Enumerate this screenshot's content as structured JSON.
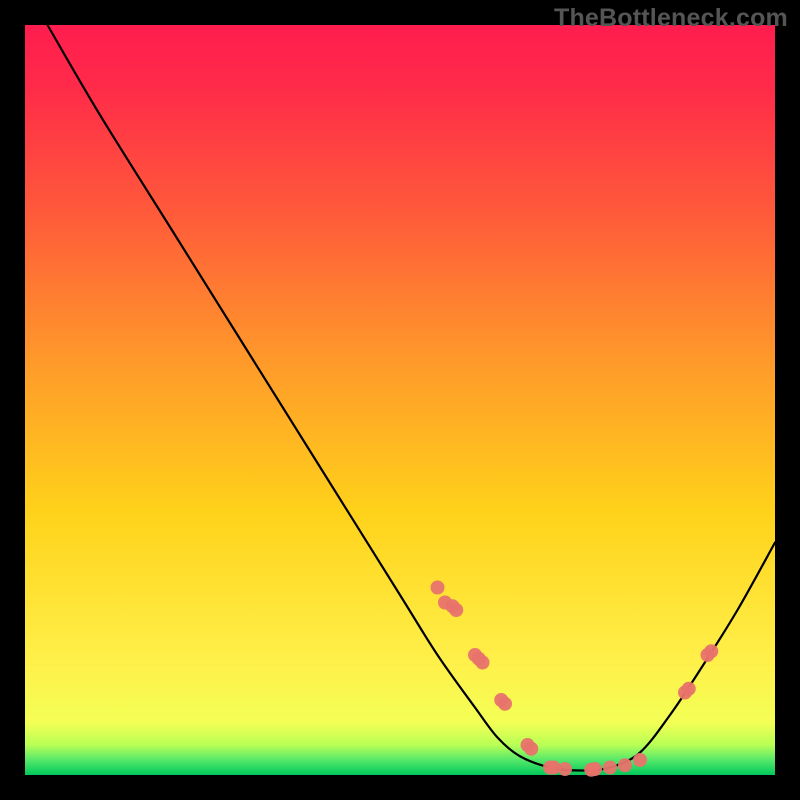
{
  "watermark": "TheBottleneck.com",
  "chart_data": {
    "type": "line",
    "title": "",
    "xlabel": "",
    "ylabel": "",
    "xlim": [
      0,
      100
    ],
    "ylim": [
      0,
      100
    ],
    "background_gradient": {
      "top": "#ff1a4a",
      "mid": "#ffd400",
      "bottom": "#00d060"
    },
    "series": [
      {
        "name": "curve",
        "note": "approximate V-shaped bottleneck curve; y = percent (higher = worse), x = normalized position",
        "x": [
          3,
          10,
          20,
          30,
          40,
          50,
          55,
          60,
          63,
          66,
          70,
          74,
          78,
          82,
          86,
          90,
          95,
          100
        ],
        "y": [
          100,
          88,
          72,
          56,
          40,
          24,
          16,
          9,
          5,
          2.5,
          1,
          0.6,
          1,
          3,
          8,
          14,
          22,
          31
        ]
      }
    ],
    "markers": {
      "name": "highlighted-points",
      "note": "pink dots overlaid on the curve near the valley and right slope",
      "points": [
        {
          "x": 55,
          "y": 25
        },
        {
          "x": 56,
          "y": 23
        },
        {
          "x": 57,
          "y": 22.5
        },
        {
          "x": 57.5,
          "y": 22
        },
        {
          "x": 60,
          "y": 16
        },
        {
          "x": 60.5,
          "y": 15.5
        },
        {
          "x": 61,
          "y": 15
        },
        {
          "x": 63.5,
          "y": 10
        },
        {
          "x": 64,
          "y": 9.5
        },
        {
          "x": 67,
          "y": 4
        },
        {
          "x": 67.5,
          "y": 3.5
        },
        {
          "x": 70,
          "y": 1
        },
        {
          "x": 70.5,
          "y": 1
        },
        {
          "x": 72,
          "y": 0.8
        },
        {
          "x": 75.5,
          "y": 0.7
        },
        {
          "x": 76,
          "y": 0.8
        },
        {
          "x": 78,
          "y": 1
        },
        {
          "x": 80,
          "y": 1.3
        },
        {
          "x": 82,
          "y": 2
        },
        {
          "x": 88,
          "y": 11
        },
        {
          "x": 88.5,
          "y": 11.5
        },
        {
          "x": 91,
          "y": 16
        },
        {
          "x": 91.5,
          "y": 16.5
        }
      ],
      "color": "#e8736b",
      "radius": 7
    },
    "frame": {
      "outer_size": 800,
      "plot_inset": 25,
      "border_color": "#000000",
      "border_width": 25
    }
  }
}
